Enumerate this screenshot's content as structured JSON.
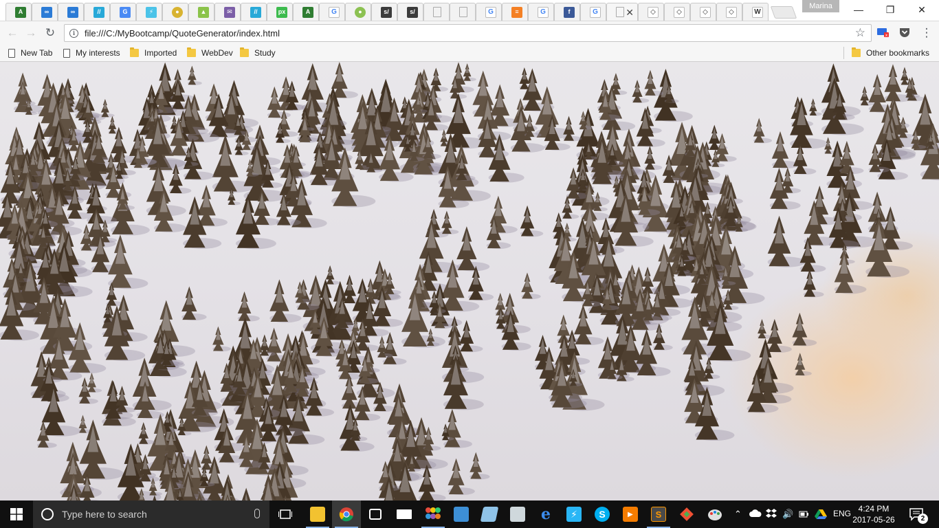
{
  "browser": {
    "tabs": [
      {
        "icon": "android-studio-icon",
        "glyph": "A",
        "color": "#2f7d32"
      },
      {
        "icon": "infinity-icon",
        "glyph": "∞",
        "color": "#2b7bd6"
      },
      {
        "icon": "infinity-icon",
        "glyph": "∞",
        "color": "#2b7bd6"
      },
      {
        "icon": "stripes-icon",
        "glyph": "//",
        "color": "#28a9d8"
      },
      {
        "icon": "google-translate-icon",
        "glyph": "G",
        "color": "#4a8af4"
      },
      {
        "icon": "lightning-icon",
        "glyph": "⚡",
        "color": "#4bc3e8"
      },
      {
        "icon": "globe-icon",
        "glyph": "●",
        "color": "#d8b330"
      },
      {
        "icon": "android-icon",
        "glyph": "▲",
        "color": "#8bc34a"
      },
      {
        "icon": "mail-icon",
        "glyph": "✉",
        "color": "#7b5ea7"
      },
      {
        "icon": "stripes-icon",
        "glyph": "//",
        "color": "#28a9d8"
      },
      {
        "icon": "px-icon",
        "glyph": "px",
        "color": "#3dbb4e"
      },
      {
        "icon": "android-studio-icon",
        "glyph": "A",
        "color": "#2f7d32"
      },
      {
        "icon": "google-icon",
        "glyph": "G",
        "color": "#ffffff"
      },
      {
        "icon": "leaf-icon",
        "glyph": "●",
        "color": "#8cc152"
      },
      {
        "icon": "script-icon",
        "glyph": "s/",
        "color": "#3b3b3b"
      },
      {
        "icon": "script-icon",
        "glyph": "s/",
        "color": "#3b3b3b"
      },
      {
        "icon": "page-icon",
        "glyph": "",
        "color": "plain"
      },
      {
        "icon": "page-icon",
        "glyph": "",
        "color": "plain"
      },
      {
        "icon": "google-icon",
        "glyph": "G",
        "color": "#ffffff"
      },
      {
        "icon": "stack-overflow-icon",
        "glyph": "≡",
        "color": "#f48024"
      },
      {
        "icon": "google-icon",
        "glyph": "G",
        "color": "#ffffff"
      },
      {
        "icon": "facebook-icon",
        "glyph": "f",
        "color": "#3b5998"
      },
      {
        "icon": "google-icon",
        "glyph": "G",
        "color": "#ffffff"
      },
      {
        "icon": "page-icon",
        "glyph": "",
        "color": "plain",
        "active": true
      },
      {
        "icon": "codepen-icon",
        "glyph": "◇",
        "color": "#ffffff"
      },
      {
        "icon": "codepen-icon",
        "glyph": "◇",
        "color": "#ffffff"
      },
      {
        "icon": "codepen-icon",
        "glyph": "◇",
        "color": "#ffffff"
      },
      {
        "icon": "codepen-icon",
        "glyph": "◇",
        "color": "#ffffff"
      },
      {
        "icon": "wikipedia-icon",
        "glyph": "W",
        "color": "#ffffff"
      }
    ],
    "profile_name": "Marina",
    "url": "file:///C:/MyBootcamp/QuoteGenerator/index.html",
    "bookmarks": {
      "items": [
        {
          "label": "New Tab",
          "icon": "page-icon"
        },
        {
          "label": "My interests",
          "icon": "page-icon"
        },
        {
          "label": "Imported",
          "icon": "folder-icon"
        },
        {
          "label": "WebDev",
          "icon": "folder-icon"
        },
        {
          "label": "Study",
          "icon": "folder-icon"
        }
      ],
      "other": "Other bookmarks"
    }
  },
  "taskbar": {
    "search_placeholder": "Type here to search",
    "language": "ENG",
    "time": "4:24 PM",
    "date": "2017-05-26",
    "notifications": "2"
  }
}
